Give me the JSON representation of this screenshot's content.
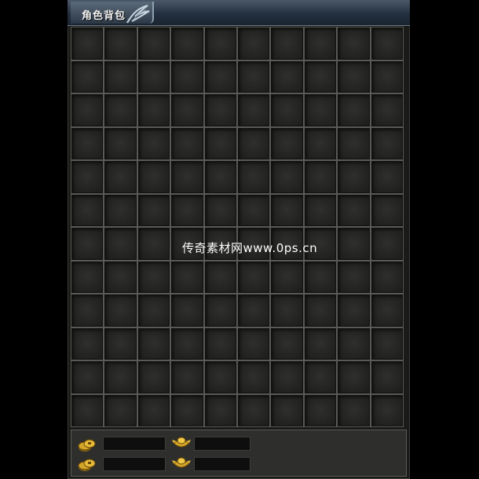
{
  "window": {
    "title": "角色背包"
  },
  "grid": {
    "columns": 10,
    "rows": 12
  },
  "currency": [
    {
      "name": "gold-coins",
      "icon": "gold-coin-stack-icon",
      "value": ""
    },
    {
      "name": "gold-ingot",
      "icon": "gold-ingot-icon",
      "value": ""
    },
    {
      "name": "bound-gold-coins",
      "icon": "gold-coin-stack-icon",
      "value": ""
    },
    {
      "name": "bound-gold-ingot",
      "icon": "gold-ingot-icon",
      "value": ""
    }
  ],
  "watermark": "传奇素材网www.0ps.cn",
  "colors": {
    "gold": "#d4a62a",
    "panel": "#1a1a18",
    "title_bar": "#2c3846"
  }
}
